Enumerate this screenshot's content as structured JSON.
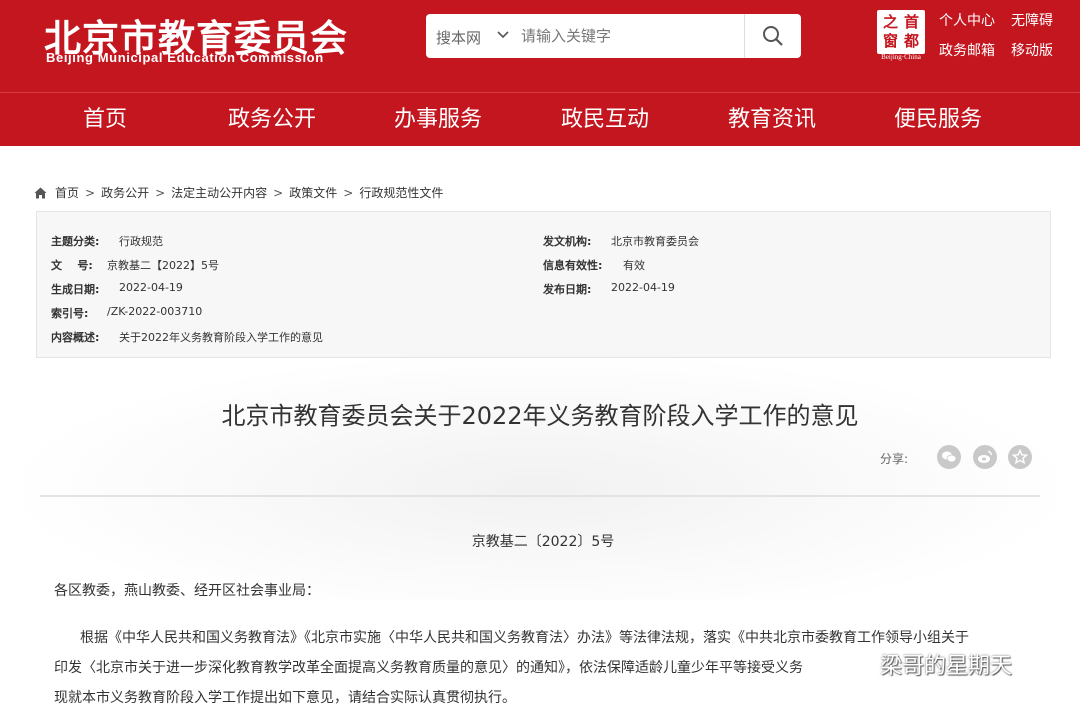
{
  "header": {
    "logo_cn": "北京市教育委员会",
    "logo_en": "Beijing Municipal Education Commission",
    "seal_chars": [
      "之",
      "首",
      "窗",
      "都"
    ],
    "seal_en": "Beijing·China",
    "links": {
      "personal_center": "个人中心",
      "accessibility": "无障碍",
      "gov_mail": "政务邮箱",
      "mobile": "移动版"
    },
    "brand_color": "#c3161f"
  },
  "search": {
    "scope": "搜本网",
    "placeholder": "请输入关键字",
    "value": ""
  },
  "nav": {
    "items": [
      {
        "label": "首页"
      },
      {
        "label": "政务公开"
      },
      {
        "label": "办事服务"
      },
      {
        "label": "政民互动"
      },
      {
        "label": "教育资讯"
      },
      {
        "label": "便民服务"
      }
    ]
  },
  "breadcrumb": [
    "首页",
    "政务公开",
    "法定主动公开内容",
    "政策文件",
    "行政规范性文件"
  ],
  "meta": {
    "topic_label": "主题分类:",
    "topic_value": "行政规范",
    "issuer_label": "发文机构:",
    "issuer_value": "北京市教育委员会",
    "docno_label": "文    号:",
    "docno_value": "京教基二【2022】5号",
    "validity_label": "信息有效性:",
    "validity_value": "有效",
    "created_label": "生成日期:",
    "created_value": "2022-04-19",
    "published_label": "发布日期:",
    "published_value": "2022-04-19",
    "index_label": "索引号:",
    "index_value": "/ZK-2022-003710",
    "summary_label": "内容概述:",
    "summary_value": "关于2022年义务教育阶段入学工作的意见"
  },
  "article": {
    "title": "北京市教育委员会关于2022年义务教育阶段入学工作的意见",
    "share_label": "分享:",
    "doc_number": "京教基二〔2022〕5号",
    "salutation": "各区教委，燕山教委、经开区社会事业局：",
    "para_line1": "根据《中华人民共和国义务教育法》《北京市实施〈中华人民共和国义务教育法〉办法》等法律法规，落实《中共北京市委教育工作领导小组关于",
    "para_line2": "印发〈北京市关于进一步深化教育教学改革全面提高义务教育质量的意见〉的通知》，依法保障适龄儿童少年平等接受义务",
    "para_line3": "现就本市义务教育阶段入学工作提出如下意见，请结合实际认真贯彻执行。"
  },
  "watermark": {
    "text": "梁哥的星期天"
  }
}
